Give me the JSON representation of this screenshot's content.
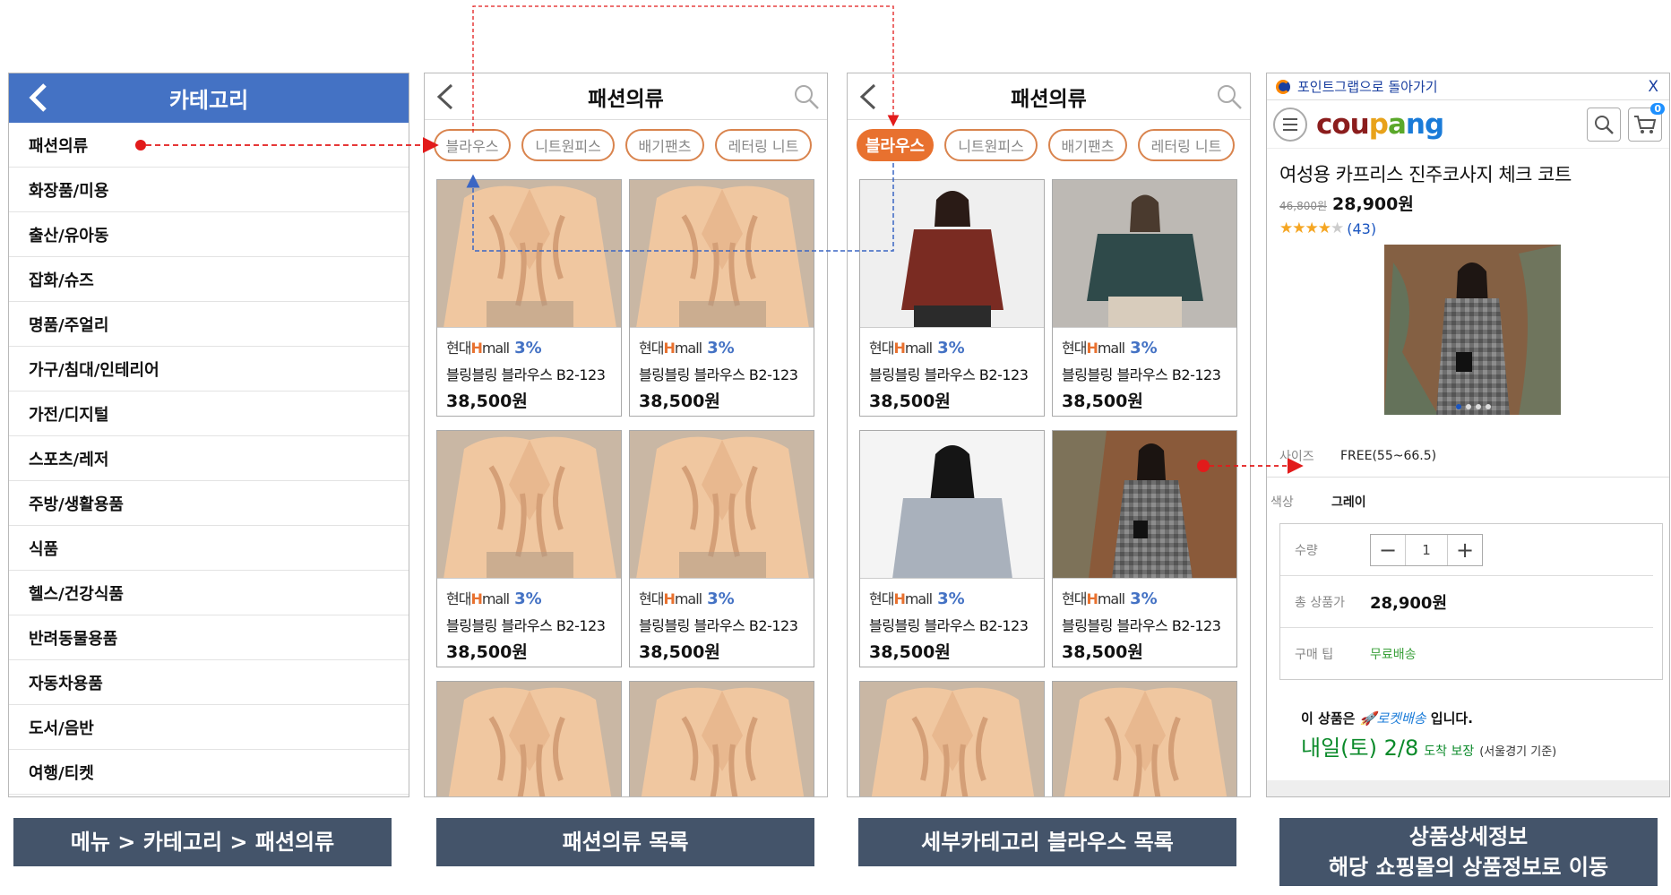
{
  "categories_panel": {
    "title": "카테고리",
    "items": [
      "패션의류",
      "화장품/미용",
      "출산/유아동",
      "잡화/슈즈",
      "명품/주얼리",
      "가구/침대/인테리어",
      "가전/디지털",
      "스포츠/레저",
      "주방/생활용품",
      "식품",
      "헬스/건강식품",
      "반려동물용품",
      "자동차용품",
      "도서/음반",
      "여행/티켓"
    ]
  },
  "fashion_list_panel": {
    "title": "패션의류",
    "chips": [
      "블라우스",
      "니트원피스",
      "배기팬츠",
      "레터링 니트"
    ],
    "active_chip": ""
  },
  "blouse_list_panel": {
    "title": "패션의류",
    "chips": [
      "블라우스",
      "니트원피스",
      "배기팬츠",
      "레터링 니트"
    ],
    "active_chip": "블라우스"
  },
  "product_card": {
    "brand_prefix": "현대",
    "brand_h": "H",
    "brand_suffix": "mall",
    "discount": "3%",
    "name": "블링블링 블라우스 B2-123",
    "price": "38,500원"
  },
  "detail_panel": {
    "back_link": "포인트그랩으로 돌아가기",
    "close": "X",
    "logo": "coupang",
    "cart_count": "0",
    "product_title": "여성용 카프리스 진주코사지 체크 코트",
    "old_price": "46,800원",
    "price": "28,900원",
    "rating_stars": "★★★★★",
    "rating_count": "(43)",
    "size_label": "사이즈",
    "size_value": "FREE(55~66.5)",
    "color_label": "색상",
    "color_value": "그레이",
    "qty_label": "수량",
    "qty_minus": "−",
    "qty_value": "1",
    "qty_plus": "+",
    "total_label": "총 상품가",
    "total_value": "28,900원",
    "tip_label": "구매 팁",
    "tip_value": "무료배송",
    "rocket_prefix": "이 상품은",
    "rocket_label": "🚀로켓배송",
    "rocket_suffix": "입니다.",
    "arrival_big": "내일(토) 2/8",
    "arrival_small": "도착 보장",
    "arrival_note": "(서울경기 기준)"
  },
  "captions": {
    "c1": "메뉴 > 카테고리 > 패션의류",
    "c2": "패션의류 목록",
    "c3": "세부카테고리 블라우스 목록",
    "c4_line1": "상품상세정보",
    "c4_line2": "해당 쇼핑몰의 상품정보로 이동"
  },
  "colors": {
    "header_blue": "#4472c4",
    "chip_orange": "#e8712f",
    "caption_bg": "#44546a",
    "arrow_red": "#e21b1b",
    "arrow_blue": "#3a66c4"
  },
  "icons": [
    "back-chevron-icon",
    "search-icon",
    "hamburger-icon",
    "cart-icon",
    "rocket-icon",
    "star-icon"
  ]
}
